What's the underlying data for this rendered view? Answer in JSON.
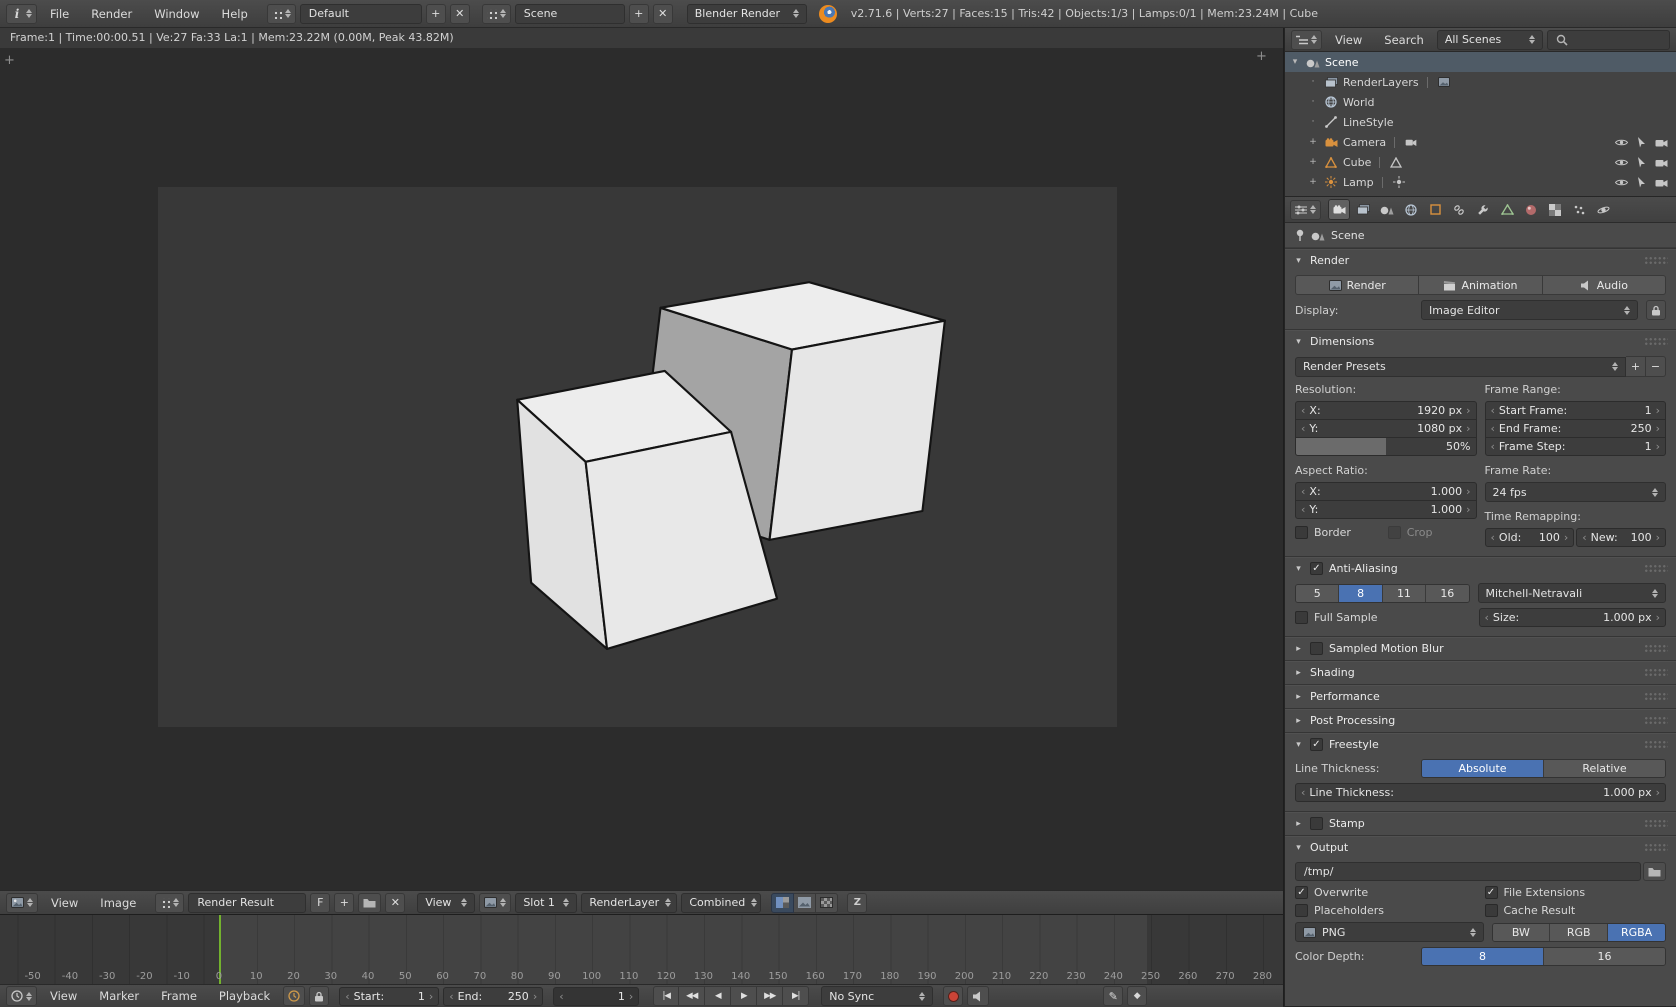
{
  "icons": {
    "plus": "+",
    "minus": "−",
    "close": "✕",
    "pencil": "✎",
    "keyframe": "◆"
  },
  "colors": {
    "accent": "#4a72b2",
    "object_orange": "#d9913e",
    "frame_cursor_green": "#73b22e"
  },
  "top_header": {
    "menus": [
      {
        "label": "File"
      },
      {
        "label": "Render"
      },
      {
        "label": "Window"
      },
      {
        "label": "Help"
      }
    ],
    "layout_name": "Default",
    "scene_name": "Scene",
    "engine": "Blender Render",
    "stats": "v2.71.6 | Verts:27 | Faces:15 | Tris:42 | Objects:1/3 | Lamps:0/1 | Mem:23.24M | Cube"
  },
  "image_editor": {
    "render_stats": "Frame:1 | Time:00:00.51 | Ve:27 Fa:33 La:1 | Mem:23.22M (0.00M, Peak 43.82M)",
    "header": {
      "menus": [
        {
          "label": "View"
        },
        {
          "label": "Image"
        }
      ],
      "image_name": "Render Result",
      "fake_user_label": "F",
      "view_dropdown": "View",
      "slot": "Slot 1",
      "render_layer": "RenderLayer",
      "render_pass": "Combined"
    }
  },
  "timeline": {
    "ruler": [
      "-50",
      "-40",
      "-30",
      "-20",
      "-10",
      "0",
      "10",
      "20",
      "30",
      "40",
      "50",
      "60",
      "70",
      "80",
      "90",
      "100",
      "110",
      "120",
      "130",
      "140",
      "150",
      "160",
      "170",
      "180",
      "190",
      "200",
      "210",
      "220",
      "230",
      "240",
      "250",
      "260",
      "270",
      "280"
    ],
    "menus": [
      {
        "label": "View"
      },
      {
        "label": "Marker"
      },
      {
        "label": "Frame"
      },
      {
        "label": "Playback"
      }
    ],
    "start_label": "Start:",
    "start_value": "1",
    "end_label": "End:",
    "end_value": "250",
    "current_frame": "1",
    "playback": [
      "|◀",
      "◀◀",
      "◀",
      "▶",
      "▶▶",
      "▶|"
    ],
    "sync": "No Sync"
  },
  "outliner": {
    "menus": [
      {
        "label": "View"
      },
      {
        "label": "Search"
      }
    ],
    "scope": "All Scenes",
    "rows": [
      {
        "label": "Scene"
      },
      {
        "label": "RenderLayers"
      },
      {
        "label": "World"
      },
      {
        "label": "LineStyle"
      },
      {
        "label": "Camera"
      },
      {
        "label": "Cube"
      },
      {
        "label": "Lamp"
      }
    ]
  },
  "properties": {
    "context_name": "Scene",
    "render": {
      "title": "Render",
      "render_button": "Render",
      "animation_button": "Animation",
      "audio_button": "Audio",
      "display_label": "Display:",
      "display_value": "Image Editor"
    },
    "dimensions": {
      "title": "Dimensions",
      "presets": "Render Presets",
      "resolution_label": "Resolution:",
      "res_x_label": "X:",
      "res_x_value": "1920 px",
      "res_y_label": "Y:",
      "res_y_value": "1080 px",
      "percent": "50%",
      "aspect_label": "Aspect Ratio:",
      "aspect_x_label": "X:",
      "aspect_x_value": "1.000",
      "aspect_y_label": "Y:",
      "aspect_y_value": "1.000",
      "border_label": "Border",
      "crop_label": "Crop",
      "frame_range_label": "Frame Range:",
      "start_frame_label": "Start Frame:",
      "start_frame_value": "1",
      "end_frame_label": "End Frame:",
      "end_frame_value": "250",
      "frame_step_label": "Frame Step:",
      "frame_step_value": "1",
      "frame_rate_label": "Frame Rate:",
      "frame_rate_value": "24 fps",
      "time_remap_label": "Time Remapping:",
      "old_label": "Old:",
      "old_value": "100",
      "new_label": "New:",
      "new_value": "100"
    },
    "antialiasing": {
      "title": "Anti-Aliasing",
      "samples": [
        "5",
        "8",
        "11",
        "16"
      ],
      "filter": "Mitchell-Netravali",
      "full_sample_label": "Full Sample",
      "size_label": "Size:",
      "size_value": "1.000 px"
    },
    "collapsed": [
      {
        "title": "Sampled Motion Blur"
      },
      {
        "title": "Shading"
      },
      {
        "title": "Performance"
      },
      {
        "title": "Post Processing"
      }
    ],
    "freestyle": {
      "title": "Freestyle",
      "line_thickness_label": "Line Thickness:",
      "absolute_label": "Absolute",
      "relative_label": "Relative",
      "thickness_label": "Line Thickness:",
      "thickness_value": "1.000 px"
    },
    "stamp": {
      "title": "Stamp"
    },
    "output": {
      "title": "Output",
      "path": "/tmp/",
      "overwrite_label": "Overwrite",
      "file_extensions_label": "File Extensions",
      "placeholders_label": "Placeholders",
      "cache_result_label": "Cache Result",
      "format": "PNG",
      "bw": "BW",
      "rgb": "RGB",
      "rgba": "RGBA",
      "color_depth_label": "Color Depth:",
      "depth8": "8",
      "depth16": "16"
    }
  }
}
